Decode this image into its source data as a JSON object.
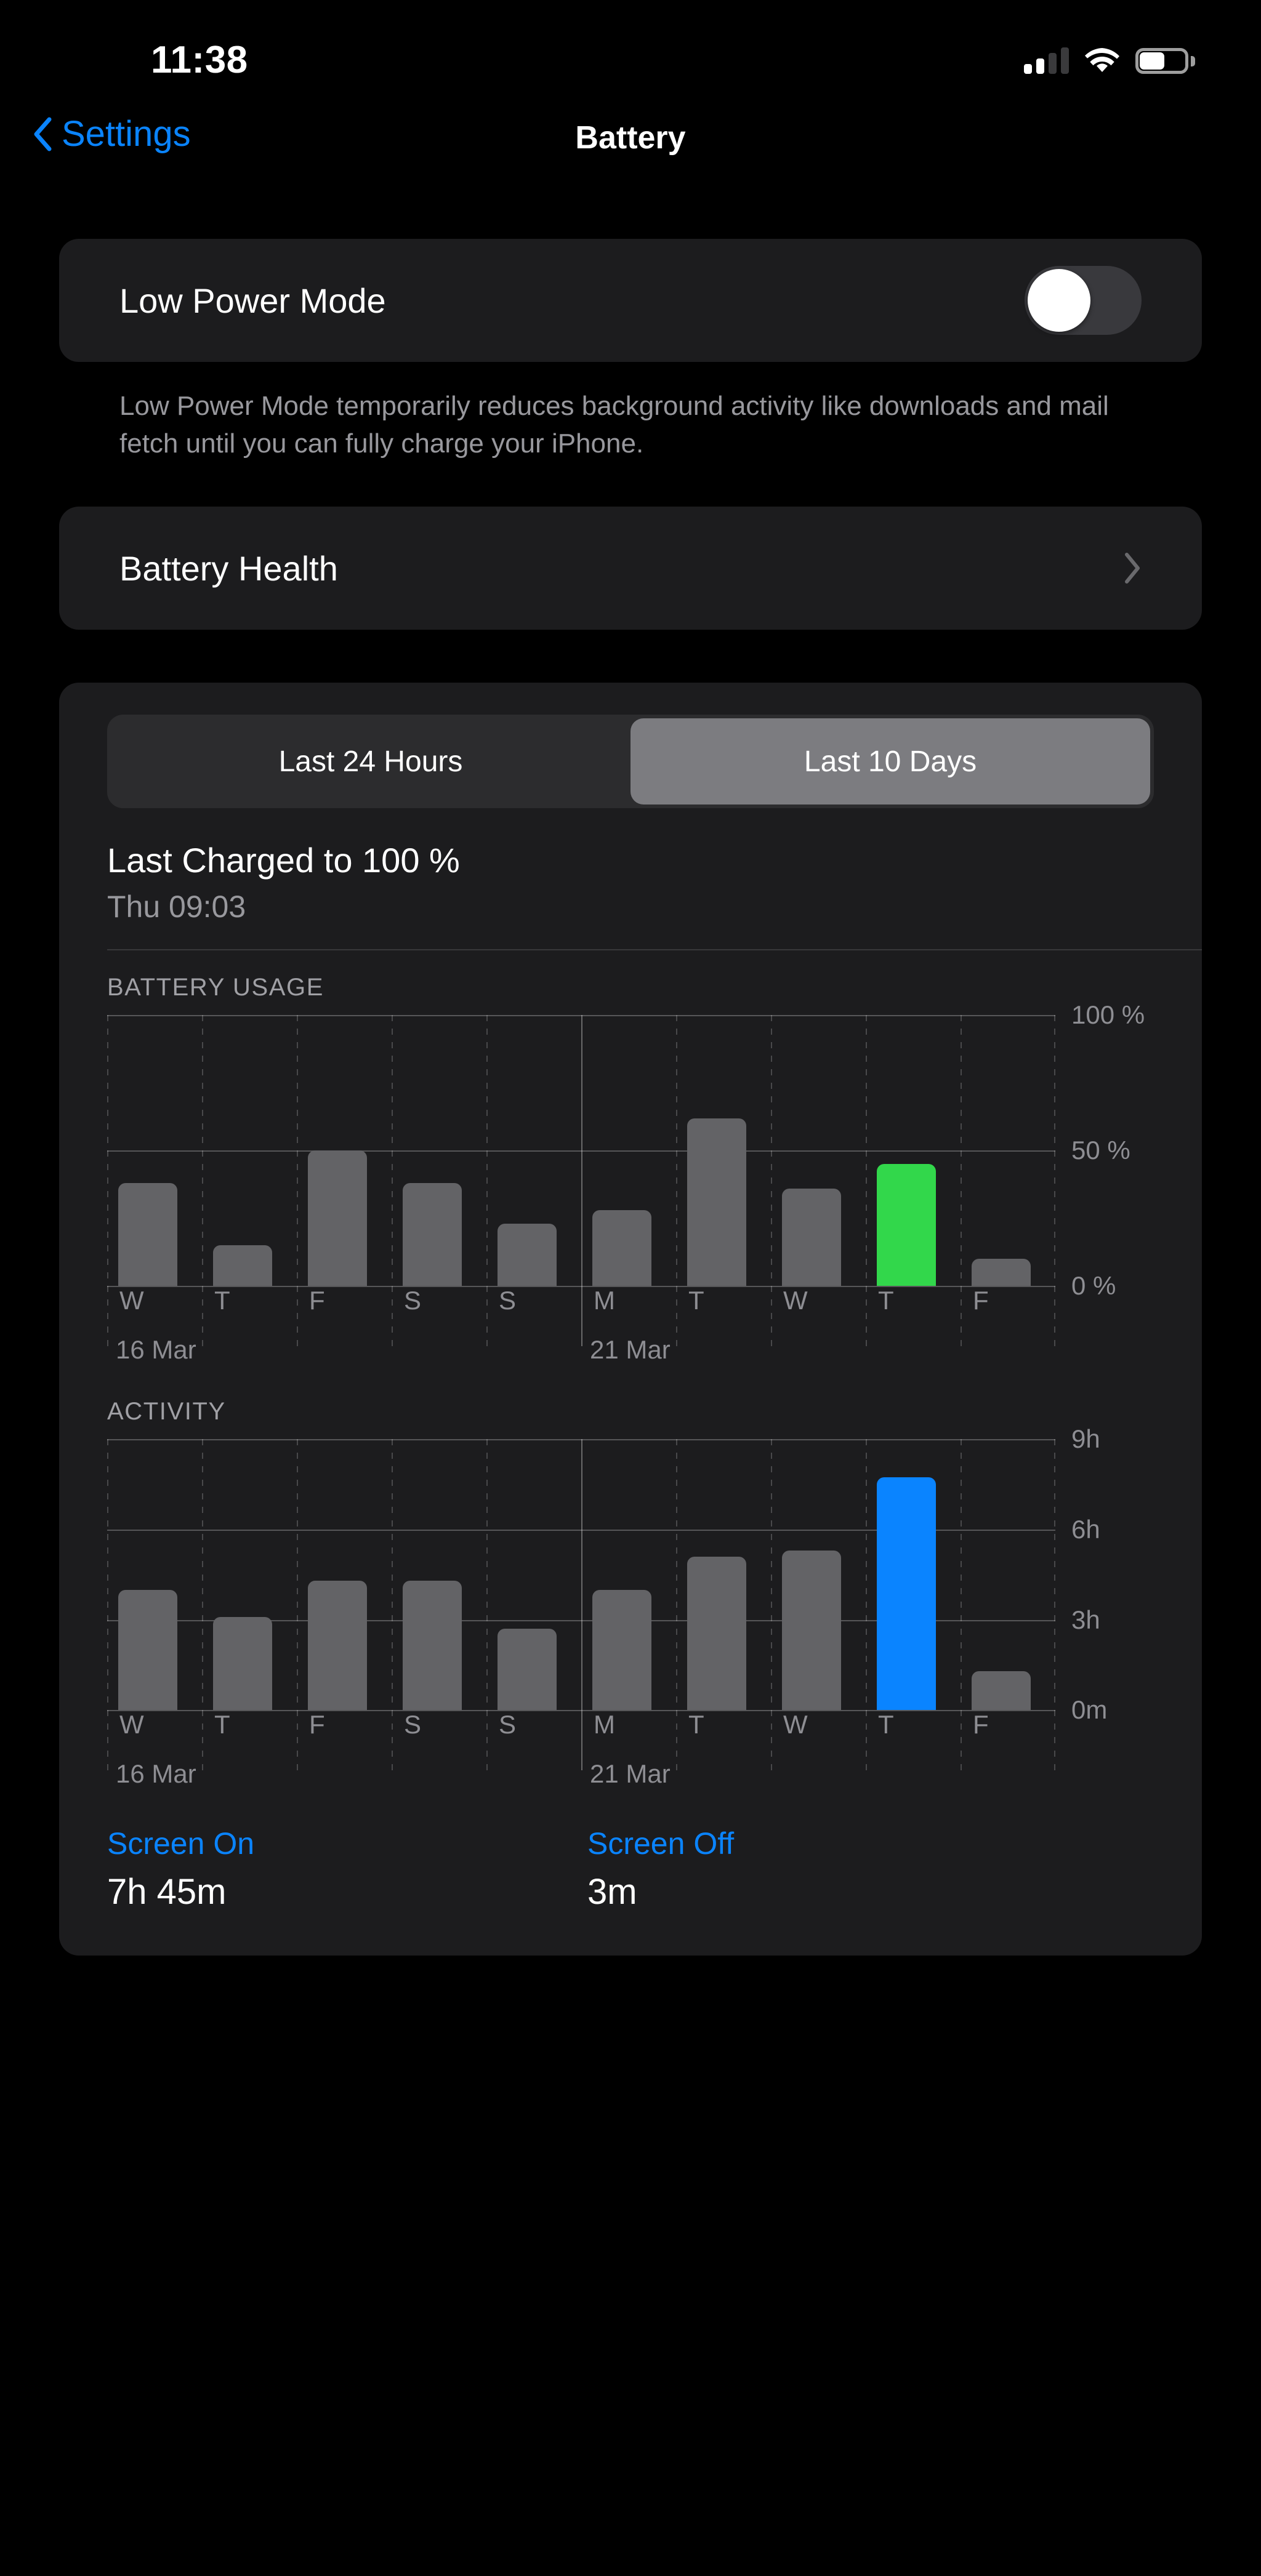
{
  "status_bar": {
    "time": "11:38",
    "signal_icon": "cellular-signal-icon",
    "wifi_icon": "wifi-icon",
    "battery_icon": "battery-icon",
    "battery_level_pct": 55
  },
  "nav": {
    "back_label": "Settings",
    "back_icon": "chevron-left-icon",
    "title": "Battery"
  },
  "low_power": {
    "label": "Low Power Mode",
    "toggle_on": false,
    "description": "Low Power Mode temporarily reduces background activity like downloads and mail fetch until you can fully charge your iPhone."
  },
  "battery_health": {
    "label": "Battery Health",
    "chevron_icon": "chevron-right-icon"
  },
  "segmented": {
    "options": [
      "Last 24 Hours",
      "Last 10 Days"
    ],
    "selected_index": 1
  },
  "last_charged": {
    "title": "Last Charged to 100 %",
    "subtitle": "Thu 09:03"
  },
  "screen_stats": {
    "screen_on_label": "Screen On",
    "screen_on_value": "7h 45m",
    "screen_off_label": "Screen Off",
    "screen_off_value": "3m"
  },
  "colors": {
    "accent_blue": "#0a84ff",
    "highlight_green": "#32d74b",
    "bar_gray": "#636366",
    "card_bg": "#1c1c1e"
  },
  "chart_data": [
    {
      "type": "bar",
      "title": "BATTERY USAGE",
      "categories": [
        "W",
        "T",
        "F",
        "S",
        "S",
        "M",
        "T",
        "W",
        "T",
        "F"
      ],
      "values": [
        38,
        15,
        50,
        38,
        23,
        28,
        62,
        36,
        45,
        10
      ],
      "highlight_index": 8,
      "highlight_color": "#32d74b",
      "bar_color": "#636366",
      "ylabel": "",
      "xlabel": "",
      "ylim": [
        0,
        100
      ],
      "yticks": [
        0,
        50,
        100
      ],
      "ytick_labels": [
        "0 %",
        "50 %",
        "100 %"
      ],
      "date_markers": [
        {
          "label": "16 Mar",
          "index": 0
        },
        {
          "label": "21 Mar",
          "index": 5
        }
      ],
      "grid": true
    },
    {
      "type": "bar",
      "title": "ACTIVITY",
      "categories": [
        "W",
        "T",
        "F",
        "S",
        "S",
        "M",
        "T",
        "W",
        "T",
        "F"
      ],
      "values": [
        4.0,
        3.1,
        4.3,
        4.3,
        2.7,
        4.0,
        5.1,
        5.3,
        7.75,
        1.3
      ],
      "highlight_index": 8,
      "highlight_color": "#0a84ff",
      "bar_color": "#636366",
      "ylabel": "",
      "xlabel": "",
      "ylim": [
        0,
        9
      ],
      "yticks": [
        0,
        3,
        6,
        9
      ],
      "ytick_labels": [
        "0m",
        "3h",
        "6h",
        "9h"
      ],
      "date_markers": [
        {
          "label": "16 Mar",
          "index": 0
        },
        {
          "label": "21 Mar",
          "index": 5
        }
      ],
      "grid": true
    }
  ]
}
